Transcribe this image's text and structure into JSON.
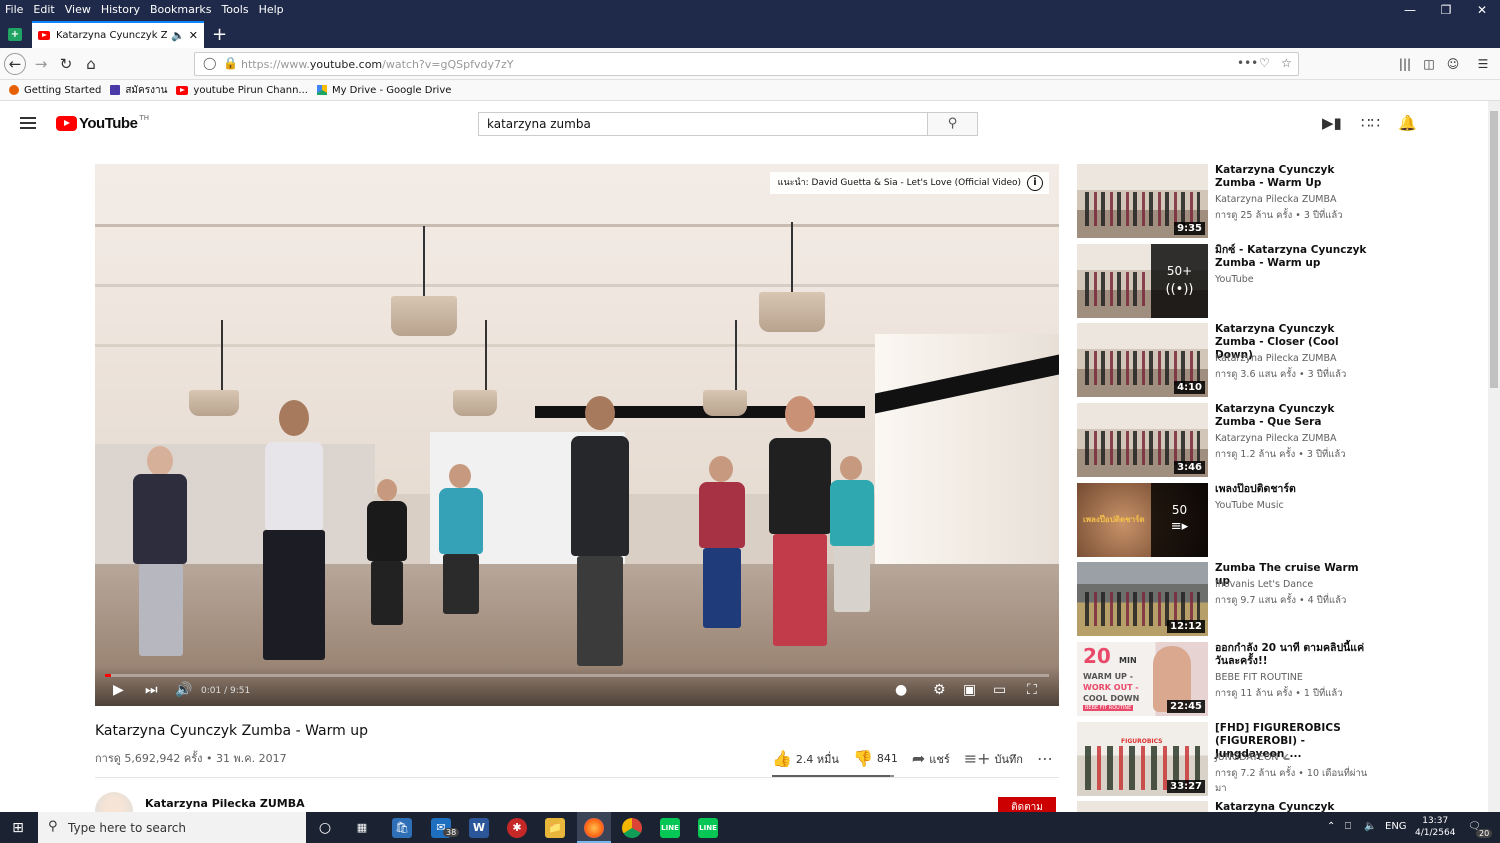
{
  "menubar": {
    "items": [
      "File",
      "Edit",
      "View",
      "History",
      "Bookmarks",
      "Tools",
      "Help"
    ]
  },
  "tab": {
    "title": "Katarzyna Cyunczyk Zumba - Warm up - YouTube"
  },
  "navbar": {
    "url_prefix": "https://www.",
    "url_domain": "youtube.com",
    "url_path": "/watch?v=gQSpfvdy7zY"
  },
  "bookmarks": [
    {
      "label": "Getting Started",
      "icon": "firefox-icon",
      "color": "#e66000"
    },
    {
      "label": "สมัครงาน",
      "icon": "list-icon",
      "color": "#4a3aa8"
    },
    {
      "label": "youtube  Pirun Chann...",
      "icon": "youtube-icon",
      "color": "#ff0000"
    },
    {
      "label": "My Drive - Google Drive",
      "icon": "drive-icon",
      "color": "#1fa463"
    }
  ],
  "youtube": {
    "logo_text": "YouTube",
    "logo_sup": "TH",
    "search_value": "katarzyna zumba"
  },
  "player": {
    "suggestion": "แนะนำ: David Guetta & Sia - Let's Love (Official Video)",
    "time": "0:01 / 9:51",
    "progress_fraction": 0.0017
  },
  "video": {
    "title": "Katarzyna Cyunczyk Zumba - Warm up",
    "meta": "การดู 5,692,942 ครั้ง • 31 พ.ค. 2017",
    "likes": "2.4 หมื่น",
    "dislikes": "841",
    "share": "แชร์",
    "save": "บันทึก",
    "like_ratio": 0.966,
    "channel": "Katarzyna Pilecka ZUMBA",
    "subscribe": "ติดตาม"
  },
  "recommendations": [
    {
      "title": "Katarzyna Cyunczyk Zumba - Warm Up",
      "channel": "Katarzyna Pilecka ZUMBA",
      "meta": "การดู 25 ล้าน ครั้ง • 3 ปีที่แล้ว",
      "duration": "9:35"
    },
    {
      "title": "มิกซ์ - Katarzyna Cyunczyk Zumba - Warm up",
      "channel": "YouTube",
      "meta": "",
      "mix_count": "50+",
      "mix_icon": "radio-icon"
    },
    {
      "title": "Katarzyna Cyunczyk Zumba - Closer (Cool Down)",
      "channel": "Katarzyna Pilecka ZUMBA",
      "meta": "การดู 3.6 แสน ครั้ง • 3 ปีที่แล้ว",
      "duration": "4:10"
    },
    {
      "title": "Katarzyna Cyunczyk Zumba - Que Sera",
      "channel": "Katarzyna Pilecka ZUMBA",
      "meta": "การดู 1.2 ล้าน ครั้ง • 3 ปีที่แล้ว",
      "duration": "3:46"
    },
    {
      "title": "เพลงป๊อปติดชาร์ต",
      "channel": "YouTube Music",
      "meta": "",
      "mix_count": "50",
      "mix_icon": "playlist-icon",
      "thumb_text": "เพลงป๊อปติดชาร์ต"
    },
    {
      "title": "Zumba The cruise Warm up",
      "channel": "Ihovanis Let's Dance",
      "meta": "การดู 9.7 แสน ครั้ง • 4 ปีที่แล้ว",
      "duration": "12:12"
    },
    {
      "title": "ออกกำลัง 20 นาที ตามคลิปนี้แค่วันละครั้ง!!",
      "channel": "BEBE FIT ROUTINE",
      "meta": "การดู 11 ล้าน ครั้ง • 1 ปีที่แล้ว",
      "duration": "22:45",
      "thumb_big": "20",
      "thumb_min": "MIN",
      "thumb_line1": "WARM UP -",
      "thumb_line2": "WORK OUT -",
      "thumb_line3": "COOL DOWN",
      "thumb_brand": "BEBE FIT ROUTINE"
    },
    {
      "title": "[FHD] FIGUREROBICS (FIGUREROBI) - Jungdayeon_...",
      "channel": "JUNGDAYEON",
      "meta": "การดู 7.2 ล้าน ครั้ง • 10 เดือนที่ผ่านมา",
      "duration": "33:27",
      "thumb_text": "FIGUROBICS",
      "verified": "✔"
    },
    {
      "title": "Katarzyna Cyunczyk Zumba -",
      "channel": "",
      "meta": ""
    }
  ],
  "taskbar": {
    "search_placeholder": "Type here to search",
    "mail_badge": "38",
    "lang": "ENG",
    "time": "13:37",
    "date": "4/1/2564",
    "notif": "20"
  }
}
